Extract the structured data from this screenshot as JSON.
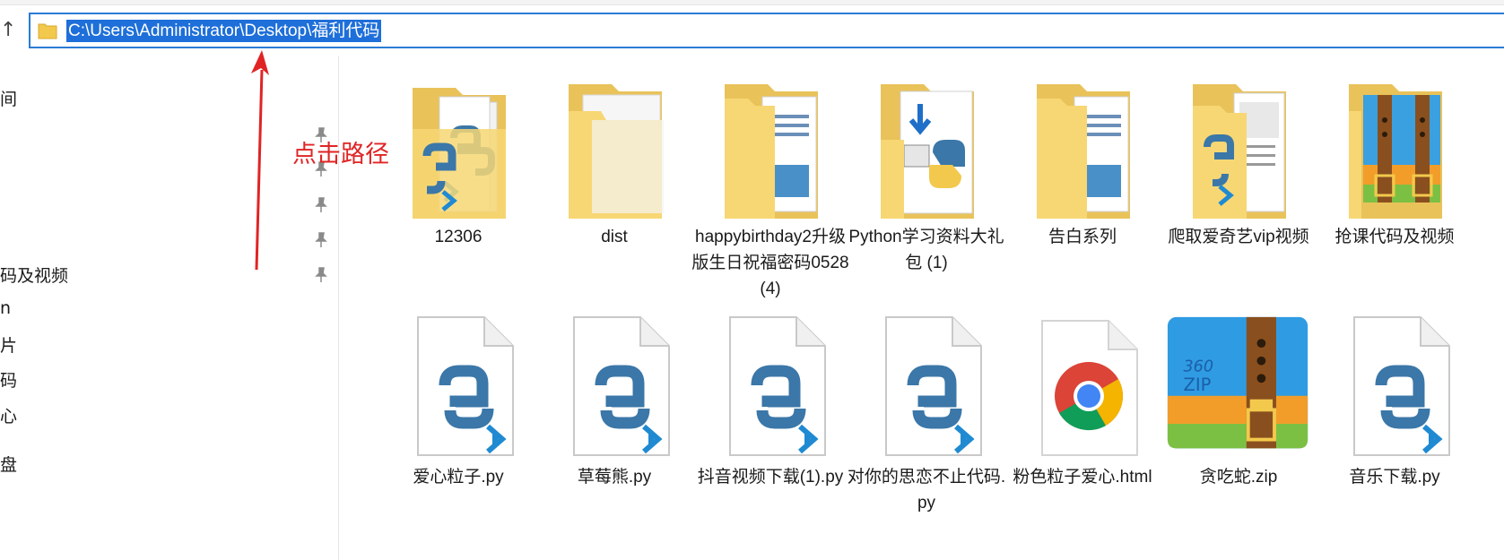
{
  "address_bar": {
    "path": "C:\\Users\\Administrator\\Desktop\\福利代码"
  },
  "nav": {
    "up_symbol": "↑"
  },
  "sidebar": {
    "items": [
      {
        "label": "间"
      },
      {
        "label": "码及视频"
      },
      {
        "label": "n"
      },
      {
        "label": "片"
      },
      {
        "label": "码"
      },
      {
        "label": "心"
      },
      {
        "label": "盘"
      }
    ]
  },
  "annotation": {
    "text": "点击路径",
    "color": "#e02424"
  },
  "files": [
    {
      "name": "12306",
      "icon": "folder-python-icon"
    },
    {
      "name": "dist",
      "icon": "folder-icon"
    },
    {
      "name": "happybirthday2升级版生日祝福密码0528(4)",
      "icon": "folder-documents-icon"
    },
    {
      "name": "Python学习资料大礼包 (1)",
      "icon": "folder-python-download-icon"
    },
    {
      "name": "告白系列",
      "icon": "folder-documents-icon"
    },
    {
      "name": "爬取爱奇艺vip视频",
      "icon": "folder-python-icon"
    },
    {
      "name": "抢课代码及视频",
      "icon": "folder-zip-icon"
    },
    {
      "name": "爱心粒子.py",
      "icon": "python-file-icon"
    },
    {
      "name": "草莓熊.py",
      "icon": "python-file-icon"
    },
    {
      "name": "抖音视频下载(1).py",
      "icon": "python-file-icon"
    },
    {
      "name": "对你的思恋不止代码.py",
      "icon": "python-file-icon"
    },
    {
      "name": "粉色粒子爱心.html",
      "icon": "chrome-html-icon"
    },
    {
      "name": "贪吃蛇.zip",
      "icon": "zip-archive-icon"
    },
    {
      "name": "音乐下载.py",
      "icon": "python-file-icon"
    }
  ],
  "zip_badge": {
    "line1": "360",
    "line2": "ZIP"
  },
  "colors": {
    "accent": "#1e6fd9",
    "folder": "#f7d774",
    "python_blue": "#3b77a8",
    "vscode_blue": "#1f8ad2"
  }
}
